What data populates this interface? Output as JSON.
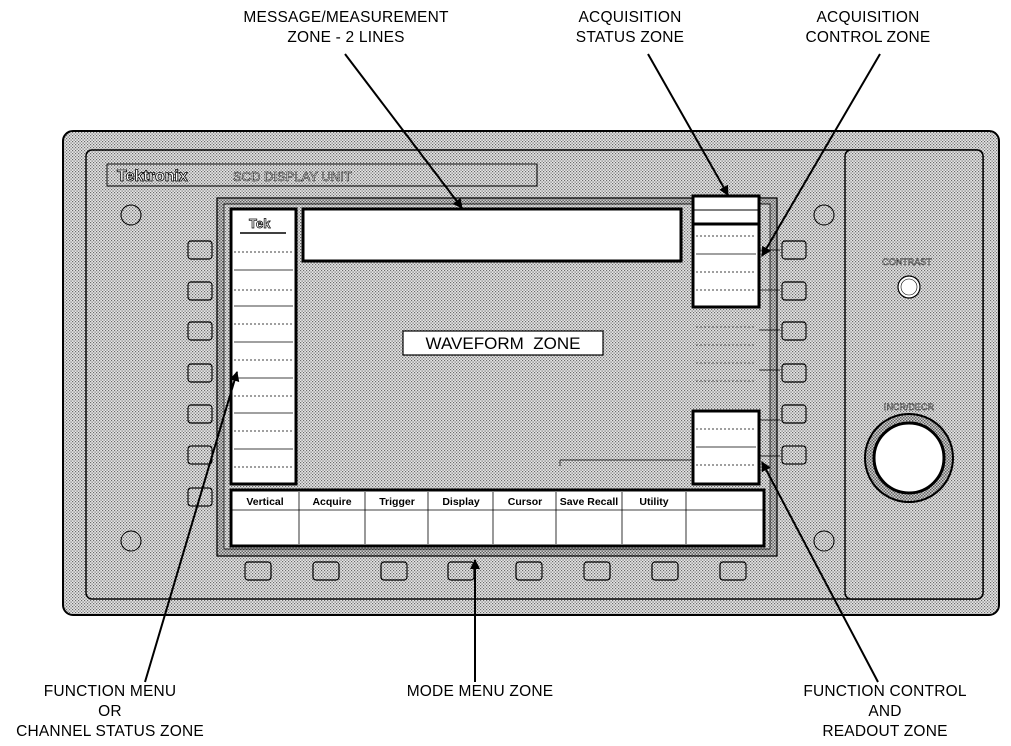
{
  "annotations": {
    "message_zone": [
      "MESSAGE/MEASUREMENT",
      "ZONE  -  2 LINES"
    ],
    "acq_status_zone": [
      "ACQUISITION",
      "STATUS ZONE"
    ],
    "acq_control_zone": [
      "ACQUISITION",
      "CONTROL ZONE"
    ],
    "function_menu_zone": [
      "FUNCTION MENU",
      "OR",
      "CHANNEL STATUS ZONE"
    ],
    "mode_menu_zone": [
      "MODE MENU ZONE"
    ],
    "function_control_zone": [
      "FUNCTION CONTROL",
      "AND",
      "READOUT ZONE"
    ]
  },
  "unit": {
    "brand": "Tektronix",
    "name": "SCD DISPLAY UNIT",
    "tek_label": "Tek",
    "waveform_zone_label": "WAVEFORM  ZONE",
    "contrast_label": "CONTRAST",
    "knob_label": "INCR/DECR"
  },
  "mode_menu_tabs": [
    "Vertical",
    "Acquire",
    "Trigger",
    "Display",
    "Cursor",
    "Save Recall",
    "Utility",
    ""
  ],
  "colors": {
    "panel_fill": "#cfcfcf",
    "ink": "#000000",
    "screen_fill": "#ffffff"
  }
}
